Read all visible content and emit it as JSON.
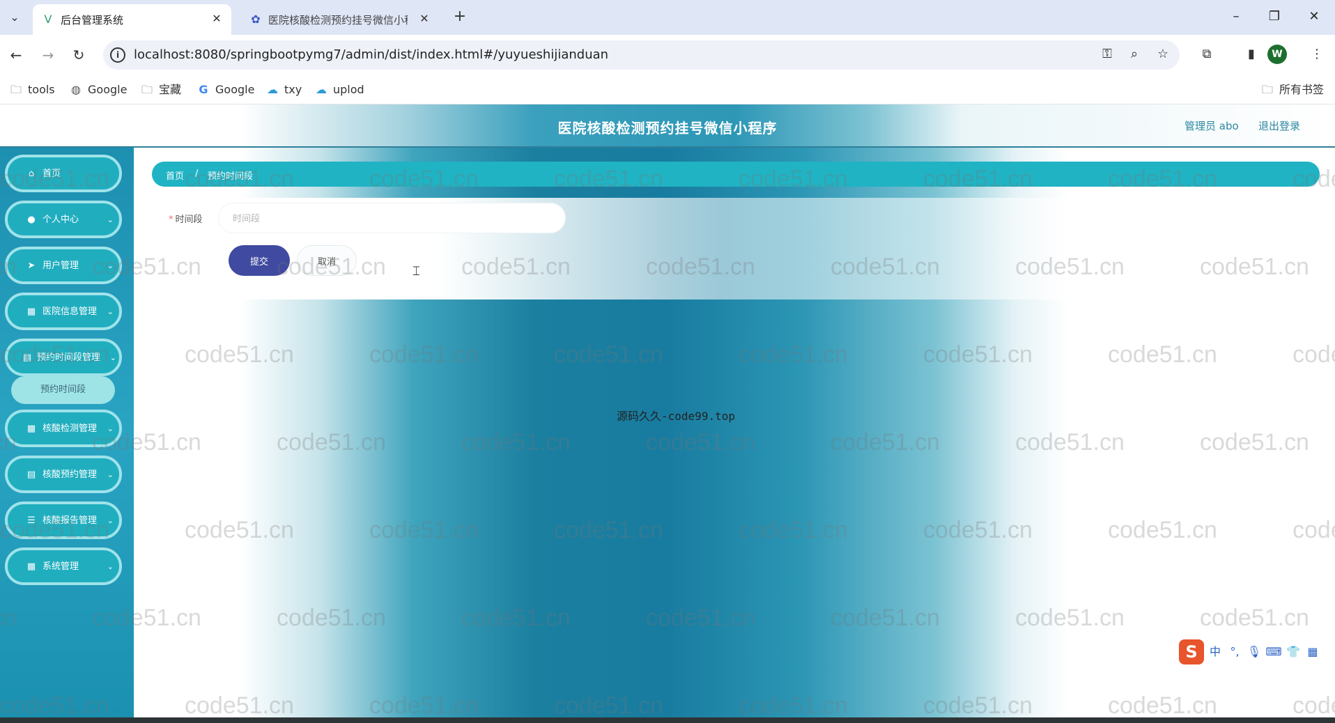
{
  "browser": {
    "tabs": [
      {
        "title": "后台管理系统",
        "active": true,
        "favicon": "vue-icon"
      },
      {
        "title": "医院核酸检测预约挂号微信小程",
        "active": false,
        "favicon": "paw-icon"
      }
    ],
    "url": "localhost:8080/springbootpymg7/admin/dist/index.html#/yuyueshijianduan",
    "profile_initial": "W",
    "bookmarks": [
      {
        "label": "tools",
        "icon": "folder-icon"
      },
      {
        "label": "Google",
        "icon": "globe-icon"
      },
      {
        "label": "宝藏",
        "icon": "folder-icon"
      },
      {
        "label": "Google",
        "icon": "google-icon"
      },
      {
        "label": "txy",
        "icon": "cloud-icon"
      },
      {
        "label": "uplod",
        "icon": "cloud-icon"
      }
    ],
    "all_bookmarks": "所有书签"
  },
  "header": {
    "title": "医院核酸检测预约挂号微信小程序",
    "admin_label": "管理员 abo",
    "logout_label": "退出登录"
  },
  "sidebar": {
    "items": [
      {
        "label": "首页",
        "icon": "home-icon",
        "has_arrow": false
      },
      {
        "label": "个人中心",
        "icon": "user-icon",
        "has_arrow": true
      },
      {
        "label": "用户管理",
        "icon": "send-icon",
        "has_arrow": true
      },
      {
        "label": "医院信息管理",
        "icon": "grid-icon",
        "has_arrow": true
      },
      {
        "label": "预约时间段管理",
        "icon": "clipboard-icon",
        "has_arrow": true,
        "expanded": true
      },
      {
        "label": "核酸检测管理",
        "icon": "grid-icon",
        "has_arrow": true
      },
      {
        "label": "核酸预约管理",
        "icon": "clipboard-icon",
        "has_arrow": true
      },
      {
        "label": "核酸报告管理",
        "icon": "sliders-icon",
        "has_arrow": true
      },
      {
        "label": "系统管理",
        "icon": "grid-icon",
        "has_arrow": true
      }
    ],
    "submenu_item": "预约时间段"
  },
  "breadcrumb": {
    "home": "首页",
    "separator": "/",
    "current": "预约时间段"
  },
  "form": {
    "field_label": "时间段",
    "required_mark": "*",
    "field_value": "",
    "field_placeholder": "时间段",
    "submit_label": "提交",
    "cancel_label": "取消"
  },
  "footer_text": "源码久久-code99.top",
  "watermark": "code51.cn",
  "colors": {
    "accent_teal": "#20b3c4",
    "submit_indigo": "#3f4aa0",
    "link": "#2b86a0"
  }
}
